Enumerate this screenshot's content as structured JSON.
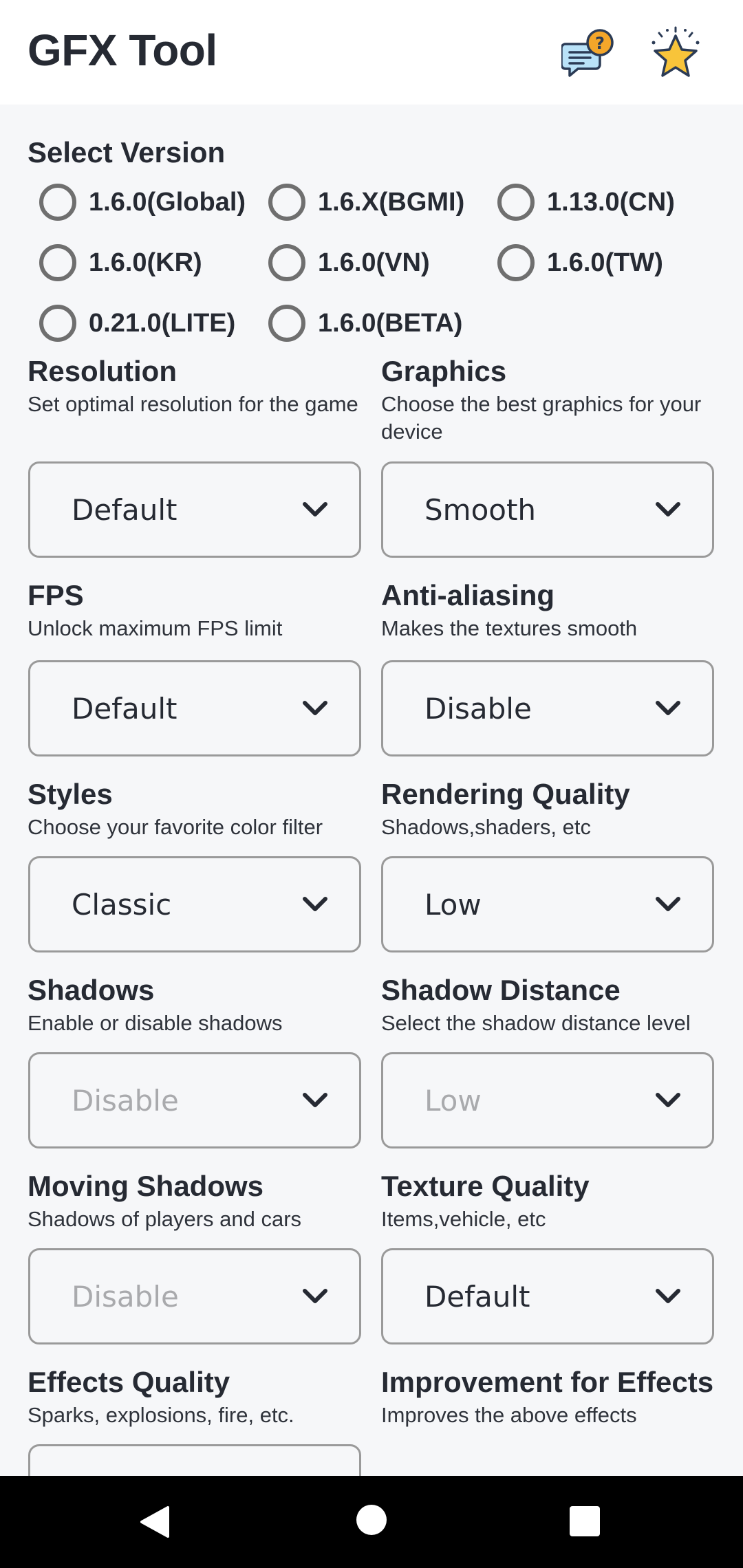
{
  "app": {
    "title": "GFX Tool"
  },
  "icons": {
    "help": "help-chat-icon",
    "rate": "star-icon",
    "dropdown": "chevron-down-icon",
    "back": "back-icon",
    "home": "home-icon",
    "recents": "recents-icon"
  },
  "colors": {
    "accent_help": "#f4a62a",
    "chat_bubble": "#b9e2f8",
    "star": "#f8c43a",
    "text": "#262a33",
    "disabled_text": "#a9aaad",
    "border": "#9a9a9a"
  },
  "version": {
    "title": "Select Version",
    "options": [
      "1.6.0(Global)",
      "1.6.X(BGMI)",
      "1.13.0(CN)",
      "1.6.0(KR)",
      "1.6.0(VN)",
      "1.6.0(TW)",
      "0.21.0(LITE)",
      "1.6.0(BETA)"
    ]
  },
  "settings": {
    "resolution": {
      "title": "Resolution",
      "desc": "Set optimal resolution for the game",
      "value": "Default"
    },
    "graphics": {
      "title": "Graphics",
      "desc": "Choose the best graphics for your device",
      "value": "Smooth"
    },
    "fps": {
      "title": "FPS",
      "desc": "Unlock maximum FPS limit",
      "value": "Default"
    },
    "antialiasing": {
      "title": "Anti-aliasing",
      "desc": "Makes the textures smooth",
      "value": "Disable"
    },
    "styles": {
      "title": "Styles",
      "desc": "Choose your favorite color filter",
      "value": "Classic"
    },
    "rendering": {
      "title": "Rendering Quality",
      "desc": "Shadows,shaders, etc",
      "value": "Low"
    },
    "shadows": {
      "title": "Shadows",
      "desc": "Enable or disable shadows",
      "value": "Disable"
    },
    "shadow_distance": {
      "title": "Shadow Distance",
      "desc": "Select the shadow distance level",
      "value": "Low"
    },
    "moving_shadows": {
      "title": "Moving Shadows",
      "desc": "Shadows of players and cars",
      "value": "Disable"
    },
    "texture": {
      "title": "Texture Quality",
      "desc": "Items,vehicle, etc",
      "value": "Default"
    },
    "effects": {
      "title": "Effects Quality",
      "desc": "Sparks, explosions, fire, etc."
    },
    "improvement": {
      "title": "Improvement for Effects",
      "desc": "Improves the above effects"
    }
  }
}
